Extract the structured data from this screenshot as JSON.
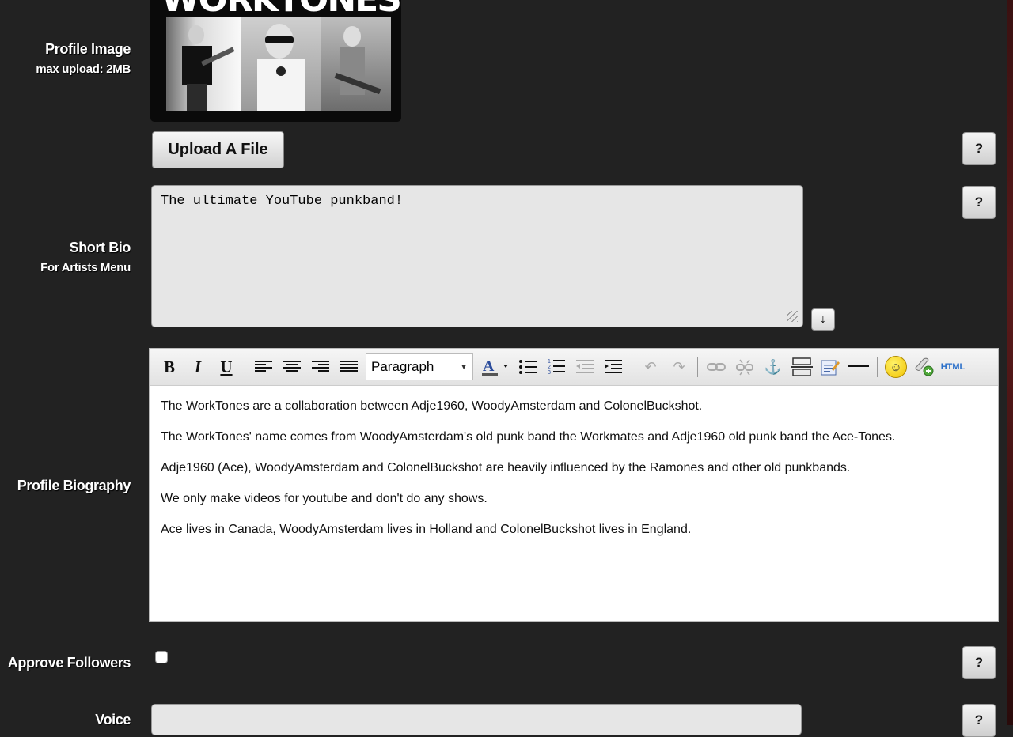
{
  "labels": {
    "profile_image": "Profile Image",
    "profile_image_sub": "max upload: 2MB",
    "short_bio": "Short Bio",
    "short_bio_sub": "For Artists Menu",
    "profile_biography": "Profile Biography",
    "approve_followers": "Approve Followers",
    "voice": "Voice"
  },
  "profile_image": {
    "logo_text": "WORKTONES"
  },
  "upload_button": "Upload A File",
  "help_label": "?",
  "short_bio_text": "The ultimate YouTube punkband!",
  "expand_icon": "↓",
  "toolbar": {
    "bold": "B",
    "italic": "I",
    "underline": "U",
    "format_select": "Paragraph",
    "html": "HTML"
  },
  "biography": [
    "The WorkTones are a collaboration between Adje1960, WoodyAmsterdam and ColonelBuckshot.",
    "The WorkTones' name comes from WoodyAmsterdam's old punk band the Workmates and Adje1960 old punk band the Ace-Tones.",
    "Adje1960 (Ace), WoodyAmsterdam and ColonelBuckshot are heavily influenced by the Ramones and other old punkbands.",
    "We only make videos for youtube and don't do any shows.",
    "Ace lives in Canada, WoodyAmsterdam lives in Holland and ColonelBuckshot lives in England."
  ],
  "approve_followers_checked": false,
  "colors": {
    "background": "#222222",
    "field": "#e6e6e6",
    "editor_bg": "#ffffff"
  }
}
